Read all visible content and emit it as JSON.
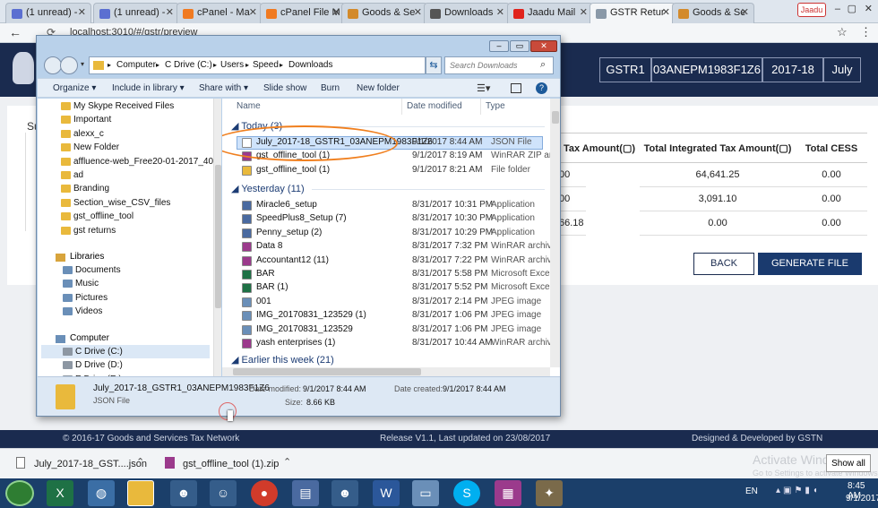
{
  "browser": {
    "tabs": [
      {
        "label": "(1 unread) -",
        "color": "#5b6fd1"
      },
      {
        "label": "(1 unread) -",
        "color": "#5b6fd1"
      },
      {
        "label": "cPanel - Ma",
        "color": "#f07a21"
      },
      {
        "label": "cPanel File M",
        "color": "#f07a21"
      },
      {
        "label": "Goods & Se",
        "color": "#d38a2b"
      },
      {
        "label": "Downloads",
        "color": "#555555"
      },
      {
        "label": "Jaadu Mail",
        "color": "#e0231c"
      },
      {
        "label": "GSTR Retur",
        "color": "#8a99a8"
      },
      {
        "label": "Goods & Se",
        "color": "#d38a2b"
      }
    ],
    "profile_label": "Jaadu",
    "url": "localhost:3010/#/gstr/preview"
  },
  "portal": {
    "form_type": "GSTR1",
    "gstin": "03ANEPM1983F1Z6",
    "fy": "2017-18",
    "month": "July",
    "section_label": "Su",
    "table": {
      "headers": [
        "Tax Amount(▢)",
        "Total Integrated Tax Amount(▢)",
        "Total CESS"
      ],
      "rows": [
        [
          "00",
          "64,641.25",
          "0.00"
        ],
        [
          "00",
          "3,091.10",
          "0.00"
        ],
        [
          "66.18",
          "0.00",
          "0.00"
        ]
      ]
    },
    "back_label": "BACK",
    "generate_label": "GENERATE FILE",
    "footer_left": "© 2016-17 Goods and Services Tax Network",
    "footer_mid": "Release V1.1, Last updated on 23/08/2017",
    "footer_right": "Designed & Developed by GSTN"
  },
  "dialog": {
    "breadcrumb": [
      "Computer",
      "C Drive (C:)",
      "Users",
      "Speed",
      "Downloads"
    ],
    "search_placeholder": "Search Downloads",
    "toolbar": [
      "Organize ▾",
      "Include in library ▾",
      "Share with ▾",
      "Slide show",
      "Burn",
      "New folder"
    ],
    "nav_folders": [
      "My Skype Received Files",
      "Important",
      "alexx_c",
      "New Folder",
      "affluence-web_Free20-01-2017_40277460",
      "ad",
      "Branding",
      "Section_wise_CSV_files",
      "gst_offline_tool",
      "gst returns"
    ],
    "libraries_label": "Libraries",
    "libraries": [
      "Documents",
      "Music",
      "Pictures",
      "Videos"
    ],
    "computer_label": "Computer",
    "drives": [
      "C Drive (C:)",
      "D Drive (D:)",
      "E Drive (E:)"
    ],
    "col_name": "Name",
    "col_date": "Date modified",
    "col_type": "Type",
    "groups": {
      "today": "Today (3)",
      "yesterday": "Yesterday (11)",
      "earlier": "Earlier this week (21)"
    },
    "today_files": [
      {
        "name": "July_2017-18_GSTR1_03ANEPM1983F1Z6",
        "date": "9/1/2017 8:44 AM",
        "type": "JSON File",
        "icon": "#ffffff"
      },
      {
        "name": "gst_offline_tool (1)",
        "date": "9/1/2017 8:19 AM",
        "type": "WinRAR ZIP archive",
        "icon": "#9b3a8c"
      },
      {
        "name": "gst_offline_tool (1)",
        "date": "9/1/2017 8:21 AM",
        "type": "File folder",
        "icon": "#e9b93c"
      }
    ],
    "yesterday_files": [
      {
        "name": "Miracle6_setup",
        "date": "8/31/2017 10:31 PM",
        "type": "Application",
        "icon": "#4a6aa0"
      },
      {
        "name": "SpeedPlus8_Setup (7)",
        "date": "8/31/2017 10:30 PM",
        "type": "Application",
        "icon": "#4a6aa0"
      },
      {
        "name": "Penny_setup (2)",
        "date": "8/31/2017 10:29 PM",
        "type": "Application",
        "icon": "#4a6aa0"
      },
      {
        "name": "Data 8",
        "date": "8/31/2017 7:32 PM",
        "type": "WinRAR archive",
        "icon": "#9b3a8c"
      },
      {
        "name": "Accountant12 (11)",
        "date": "8/31/2017 7:22 PM",
        "type": "WinRAR archive",
        "icon": "#9b3a8c"
      },
      {
        "name": "BAR",
        "date": "8/31/2017 5:58 PM",
        "type": "Microsoft Excel W",
        "icon": "#1e7145"
      },
      {
        "name": "BAR (1)",
        "date": "8/31/2017 5:52 PM",
        "type": "Microsoft Excel W",
        "icon": "#1e7145"
      },
      {
        "name": "001",
        "date": "8/31/2017 2:14 PM",
        "type": "JPEG image",
        "icon": "#6a8fb8"
      },
      {
        "name": "IMG_20170831_123529 (1)",
        "date": "8/31/2017 1:06 PM",
        "type": "JPEG image",
        "icon": "#6a8fb8"
      },
      {
        "name": "IMG_20170831_123529",
        "date": "8/31/2017 1:06 PM",
        "type": "JPEG image",
        "icon": "#6a8fb8"
      },
      {
        "name": "yash enterprises (1)",
        "date": "8/31/2017 10:44 AM",
        "type": "WinRAR archive",
        "icon": "#9b3a8c"
      }
    ],
    "details": {
      "name": "July_2017-18_GSTR1_03ANEPM1983F1Z6",
      "type": "JSON File",
      "modified_label": "Date modified:",
      "modified": "9/1/2017 8:44 AM",
      "created_label": "Date created:",
      "created": "9/1/2017 8:44 AM",
      "size_label": "Size:",
      "size": "8.66 KB"
    }
  },
  "shelf": {
    "item1": "July_2017-18_GST....json",
    "item2": "gst_offline_tool (1).zip",
    "show_all": "Show all",
    "watermark1": "Activate Windows",
    "watermark2": "Go to Settings to activate Windows."
  },
  "taskbar": {
    "lang": "EN",
    "time": "8:45 AM",
    "date": "9/1/2017"
  }
}
